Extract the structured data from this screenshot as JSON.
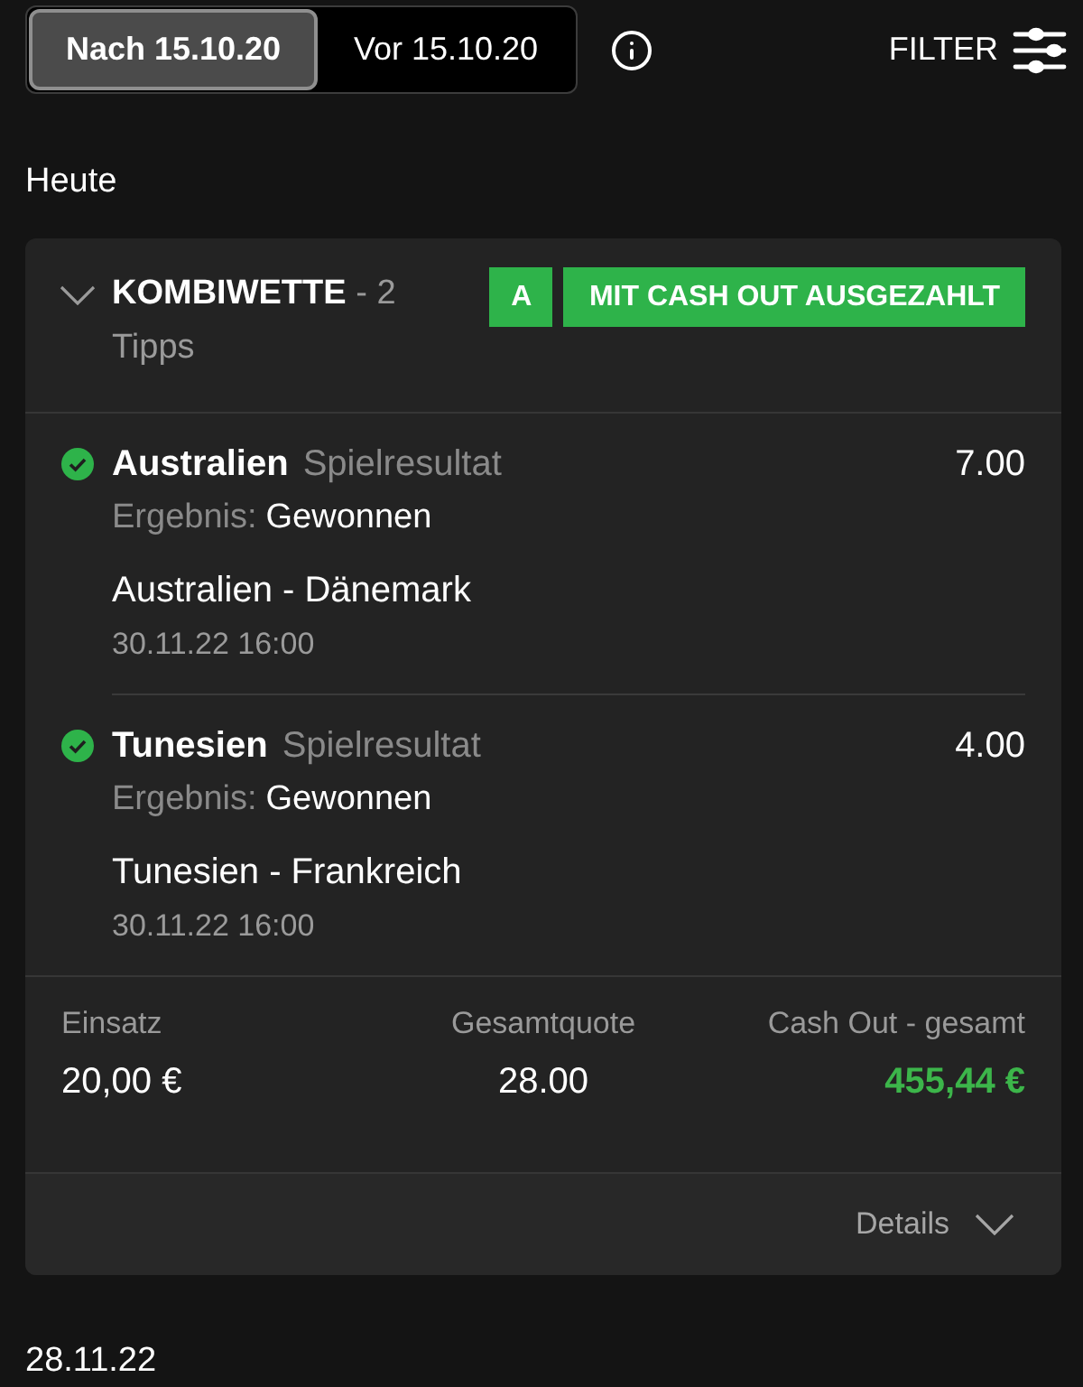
{
  "date_filter": {
    "tabs": [
      {
        "label": "Nach 15.10.20",
        "selected": true
      },
      {
        "label": "Vor 15.10.20",
        "selected": false
      }
    ]
  },
  "filter_button": {
    "label": "FILTER"
  },
  "groups": [
    {
      "date": "Heute",
      "bets": [
        {
          "title": "**KOMBIWETTE** - 2 Tipps",
          "badges": [
            "A",
            "MIT CASH OUT AUSGEZAHLT"
          ],
          "selections": [
            {
              "won": true,
              "team": "Australien",
              "market": "Spielresultat",
              "odds": "7.00",
              "result_label": "Ergebnis:",
              "result": "Gewonnen",
              "match": "Australien - Dänemark",
              "time": "30.11.22 16:00"
            },
            {
              "won": true,
              "team": "Tunesien",
              "market": "Spielresultat",
              "odds": "4.00",
              "result_label": "Ergebnis:",
              "result": "Gewonnen",
              "match": "Tunesien - Frankreich",
              "time": "30.11.22 16:00"
            }
          ],
          "summary": [
            {
              "label": "Einsatz",
              "value": "20,00 €",
              "kind": "plain"
            },
            {
              "label": "Gesamtquote",
              "value": "28.00",
              "kind": "plain"
            },
            {
              "label": "Cash Out - gesamt",
              "value": "455,44 €",
              "kind": "highlight"
            }
          ],
          "details_label": "Details"
        }
      ]
    },
    {
      "date": "28.11.22"
    }
  ]
}
